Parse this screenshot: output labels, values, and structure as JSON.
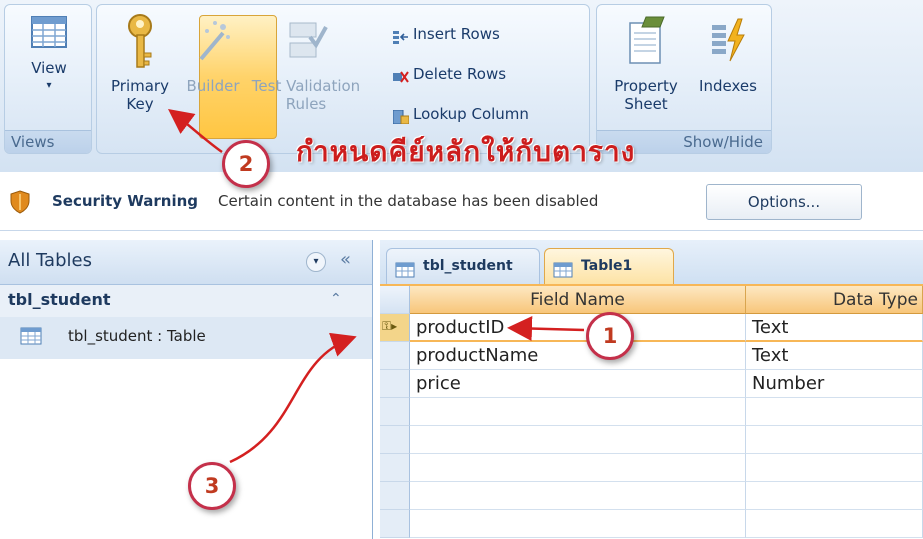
{
  "ribbon": {
    "views_group": {
      "view_label": "View",
      "group_label": "Views"
    },
    "tools_group": {
      "primary_key_label_1": "Primary",
      "primary_key_label_2": "Key",
      "builder_label": "Builder",
      "test_validation_label_1": "Test Validation",
      "test_validation_label_2": "Rules",
      "insert_rows_label": "Insert Rows",
      "delete_rows_label": "Delete Rows",
      "lookup_column_label": "Lookup Column"
    },
    "show_hide_group": {
      "property_sheet_label_1": "Property",
      "property_sheet_label_2": "Sheet",
      "indexes_label": "Indexes",
      "group_label": "Show/Hide"
    }
  },
  "security_bar": {
    "title": "Security Warning",
    "message": "Certain content in the database has been disabled",
    "options_label": "Options..."
  },
  "nav_pane": {
    "header": "All Tables",
    "section": "tbl_student",
    "item": "tbl_student : Table",
    "collapse_glyph": "«"
  },
  "tabs": [
    {
      "label": "tbl_student"
    },
    {
      "label": "Table1"
    }
  ],
  "grid": {
    "headers": [
      "Field Name",
      "Data Type"
    ],
    "rows": [
      {
        "field": "productID",
        "type": "Text"
      },
      {
        "field": "productName",
        "type": "Text"
      },
      {
        "field": "price",
        "type": "Number"
      }
    ]
  },
  "annotations": {
    "step1": "1",
    "step2": "2",
    "step3": "3",
    "thai_caption": "กำหนดคีย์หลักให้กับตาราง"
  },
  "colors": {
    "accent": "#f7b757",
    "annotation_red": "#c4304a"
  }
}
